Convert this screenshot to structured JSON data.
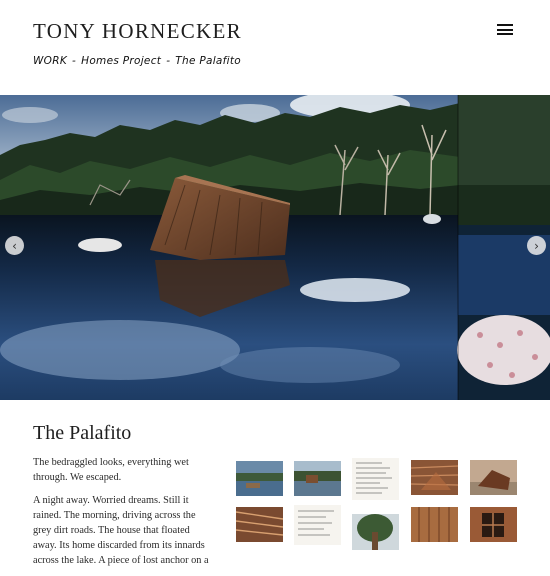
{
  "site": {
    "title": "TONY HORNECKER",
    "menu_icon": "hamburger-menu-icon"
  },
  "breadcrumb": {
    "items": [
      "WORK",
      "Homes Project",
      "The Palafito"
    ],
    "separator": "-"
  },
  "slideshow": {
    "prev_glyph": "‹",
    "next_glyph": "›",
    "prev_icon": "chevron-left-icon",
    "next_icon": "chevron-right-icon"
  },
  "project": {
    "title": "The Palafito",
    "paragraphs": [
      "The bedraggled looks, everything wet through. We escaped.",
      "A night away. Worried dreams. Still it rained. The morning, driving across the grey dirt roads. The house that floated away. Its home discarded from its innards across the lake. A piece of lost anchor on a"
    ]
  },
  "thumbnails": [
    {
      "name": "thumb-lake-1"
    },
    {
      "name": "thumb-lake-2"
    },
    {
      "name": "thumb-notes-1"
    },
    {
      "name": "thumb-wood-1"
    },
    {
      "name": "thumb-shed-1"
    },
    {
      "name": "thumb-wood-2"
    },
    {
      "name": "thumb-notes-2"
    },
    {
      "name": "thumb-tree"
    },
    {
      "name": "thumb-wood-3"
    },
    {
      "name": "thumb-window"
    }
  ]
}
